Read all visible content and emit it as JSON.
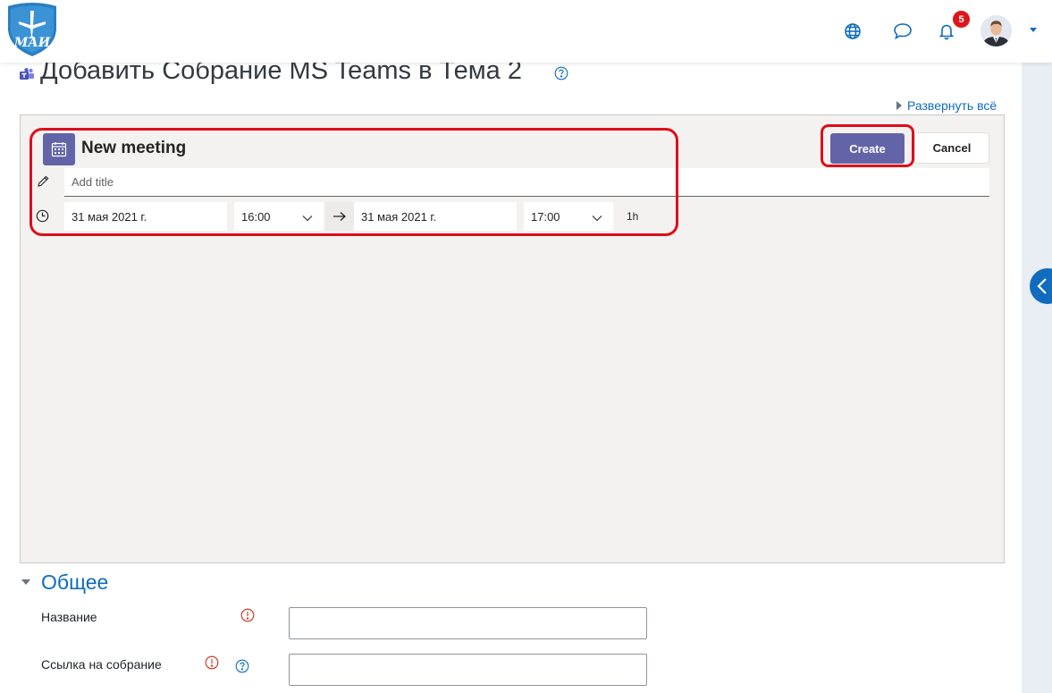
{
  "header": {
    "logo_text": "МАИ",
    "notifications_count": "5"
  },
  "page": {
    "title": "Добавить Собрание MS Teams в Тема 2",
    "expand_all": "Развернуть всё"
  },
  "teams": {
    "heading": "New meeting",
    "create_label": "Create",
    "cancel_label": "Cancel",
    "title_placeholder": "Add title",
    "start_date": "31 мая 2021 г.",
    "start_time": "16:00",
    "end_date": "31 мая 2021 г.",
    "end_time": "17:00",
    "duration": "1h"
  },
  "form": {
    "section_title": "Общее",
    "name_label": "Название",
    "link_label": "Ссылка на собрание"
  },
  "colors": {
    "teams_purple": "#6264a7",
    "moodle_blue": "#0f6cbf",
    "annotation_red": "#e00d1a"
  }
}
